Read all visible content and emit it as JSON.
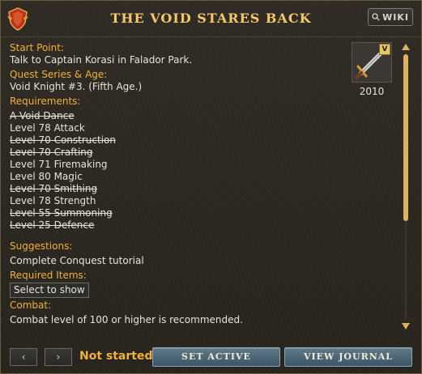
{
  "window": {
    "title": "THE VOID STARES BACK",
    "wiki_label": "WIKI"
  },
  "details": {
    "start_point_label": "Start Point:",
    "start_point_value": "Talk to Captain Korasi in Falador Park.",
    "series_label": "Quest Series & Age:",
    "series_value": "Void Knight #3. (Fifth Age.)",
    "requirements_label": "Requirements:",
    "requirements": [
      {
        "text": "A Void Dance",
        "completed": true
      },
      {
        "text": "Level 78 Attack",
        "completed": false
      },
      {
        "text": "Level 70 Construction",
        "completed": true
      },
      {
        "text": "Level 70 Crafting",
        "completed": true
      },
      {
        "text": "Level 71 Firemaking",
        "completed": false
      },
      {
        "text": "Level 80 Magic",
        "completed": false
      },
      {
        "text": "Level 70 Smithing",
        "completed": true
      },
      {
        "text": "Level 78 Strength",
        "completed": false
      },
      {
        "text": "Level 55 Summoning",
        "completed": true
      },
      {
        "text": "Level 25 Defence",
        "completed": true
      }
    ],
    "suggestions_label": "Suggestions:",
    "suggestions_value": "Complete Conquest tutorial",
    "required_items_label": "Required Items:",
    "select_to_show_label": "Select to show",
    "combat_label": "Combat:",
    "combat_value": "Combat level of 100 or higher is recommended."
  },
  "badge": {
    "icon": "sword-icon",
    "tier": "V",
    "year": "2010"
  },
  "footer": {
    "prev_label": "‹",
    "next_label": "›",
    "status": "Not started",
    "set_active_label": "SET ACTIVE",
    "view_journal_label": "VIEW JOURNAL"
  },
  "colors": {
    "label": "#f0b03c",
    "title": "#f5c86a",
    "text": "#e8e4d8",
    "button": "#4e6878"
  }
}
